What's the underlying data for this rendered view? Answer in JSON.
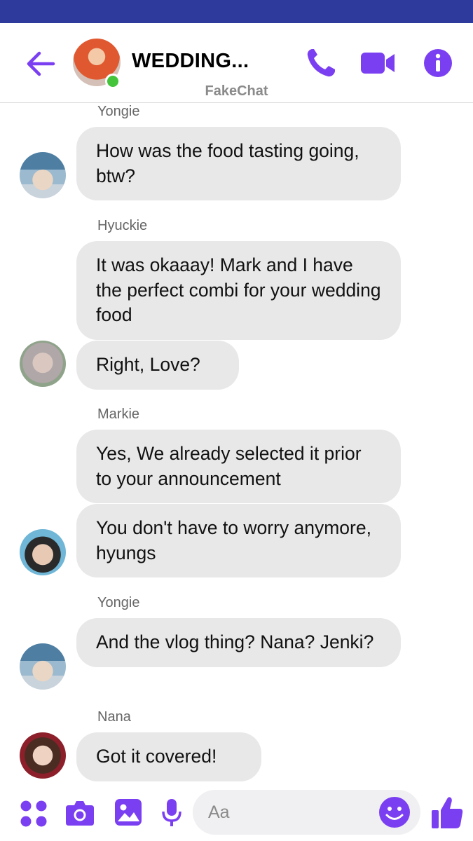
{
  "colors": {
    "accent": "#7b3ff2",
    "status_bar": "#2f3a9d",
    "bubble": "#e8e8e8",
    "online": "#43c43a"
  },
  "header": {
    "title": "WEDDING...",
    "watermark": "FakeChat",
    "icons": [
      "back-arrow-icon",
      "phone-icon",
      "video-camera-icon",
      "info-icon"
    ]
  },
  "messages": [
    {
      "sender": "Yongie",
      "bubbles": [
        "How was the food tasting going, btw?"
      ]
    },
    {
      "sender": "Hyuckie",
      "bubbles": [
        "It was okaaay! Mark and I have the perfect combi for your wedding food",
        "Right, Love?"
      ]
    },
    {
      "sender": "Markie",
      "bubbles": [
        "Yes, We already selected it prior to your announcement",
        "You don't have to worry anymore, hyungs"
      ]
    },
    {
      "sender": "Yongie",
      "bubbles": [
        "And the vlog thing?  Nana? Jenki?"
      ]
    },
    {
      "sender": "Nana",
      "bubbles": [
        "Got it covered!"
      ]
    }
  ],
  "composer": {
    "placeholder": "Aa",
    "icons": [
      "apps-icon",
      "camera-icon",
      "gallery-icon",
      "microphone-icon",
      "emoji-icon",
      "thumbs-up-icon"
    ]
  }
}
